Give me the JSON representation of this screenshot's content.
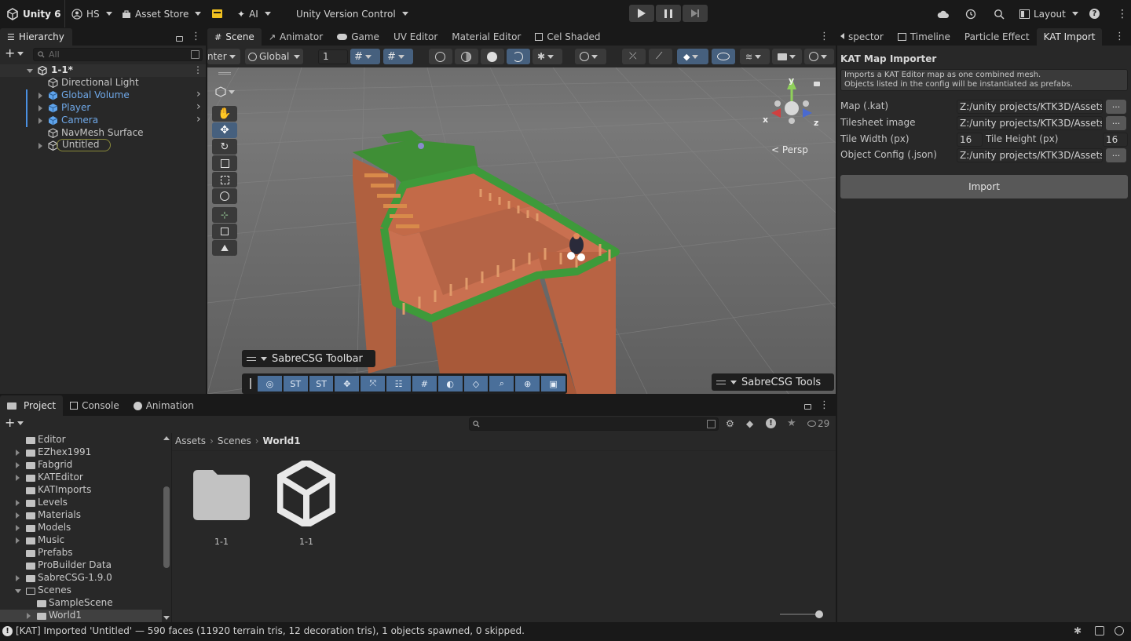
{
  "topbar": {
    "app_title": "Unity 6",
    "account": "HS",
    "asset_store": "Asset Store",
    "ai": "AI",
    "version_control": "Unity Version Control",
    "layout": "Layout"
  },
  "hierarchy": {
    "tab_label": "Hierarchy",
    "search_placeholder": "All",
    "scene_name": "1-1*",
    "items": [
      {
        "label": "Directional Light",
        "color": "#c4c4c4"
      },
      {
        "label": "Global Volume",
        "color": "#6fa8e8"
      },
      {
        "label": "Player",
        "color": "#6fa8e8"
      },
      {
        "label": "Camera",
        "color": "#6fa8e8"
      },
      {
        "label": "NavMesh Surface",
        "color": "#c4c4c4"
      },
      {
        "label": "Untitled",
        "color": "#c4c4c4"
      }
    ]
  },
  "scene_tabs": [
    "Scene",
    "Animator",
    "Game",
    "UV Editor",
    "Material Editor",
    "Cel Shaded"
  ],
  "scene_toolbar": {
    "pivot": "nter",
    "space": "Global",
    "snap_value": "1"
  },
  "viewport": {
    "axis_y": "y",
    "axis_x": "x",
    "axis_z": "z",
    "persp_label": "< Persp",
    "sabre_toolbar_label": "SabreCSG Toolbar",
    "sabre_tools_label": "SabreCSG Tools",
    "sabre_buttons": [
      "ST",
      "ST"
    ]
  },
  "inspector": {
    "tabs": [
      "spector",
      "Timeline",
      "Particle Effect",
      "KAT Import"
    ],
    "title": "KAT Map Importer",
    "help_line1": "Imports a KAT Editor map as one combined mesh.",
    "help_line2": "Objects listed in the config will be instantiated as prefabs.",
    "map_label": "Map (.kat)",
    "map_value": "Z:/unity projects/KTK3D/Assets/",
    "tilesheet_label": "Tilesheet image",
    "tilesheet_value": "Z:/unity projects/KTK3D/Assets/",
    "tile_width_label": "Tile Width (px)",
    "tile_width_value": "16",
    "tile_height_label": "Tile Height (px)",
    "tile_height_value": "16",
    "config_label": "Object Config (.json)",
    "config_value": "Z:/unity projects/KTK3D/Assets/",
    "browse": "...",
    "import_button": "Import"
  },
  "project": {
    "tabs": [
      "Project",
      "Console",
      "Animation"
    ],
    "hidden_count": "29",
    "folders": [
      {
        "label": "Editor",
        "expand": "none"
      },
      {
        "label": "EZhex1991",
        "expand": "right"
      },
      {
        "label": "Fabgrid",
        "expand": "right"
      },
      {
        "label": "KATEditor",
        "expand": "right"
      },
      {
        "label": "KATImports",
        "expand": "none"
      },
      {
        "label": "Levels",
        "expand": "right"
      },
      {
        "label": "Materials",
        "expand": "right"
      },
      {
        "label": "Models",
        "expand": "right"
      },
      {
        "label": "Music",
        "expand": "right"
      },
      {
        "label": "Prefabs",
        "expand": "none"
      },
      {
        "label": "ProBuilder Data",
        "expand": "none"
      },
      {
        "label": "SabreCSG-1.9.0",
        "expand": "right"
      },
      {
        "label": "Scenes",
        "expand": "down"
      },
      {
        "label": "SampleScene",
        "expand": "none"
      },
      {
        "label": "World1",
        "expand": "right"
      }
    ],
    "breadcrumb": [
      "Assets",
      "Scenes",
      "World1"
    ],
    "assets": [
      {
        "label": "1-1",
        "kind": "folder"
      },
      {
        "label": "1-1",
        "kind": "unity-scene"
      }
    ]
  },
  "status": {
    "message": "[KAT] Imported 'Untitled' — 590 faces (11920 terrain tris, 12 decoration tris), 1 objects spawned, 0 skipped."
  }
}
